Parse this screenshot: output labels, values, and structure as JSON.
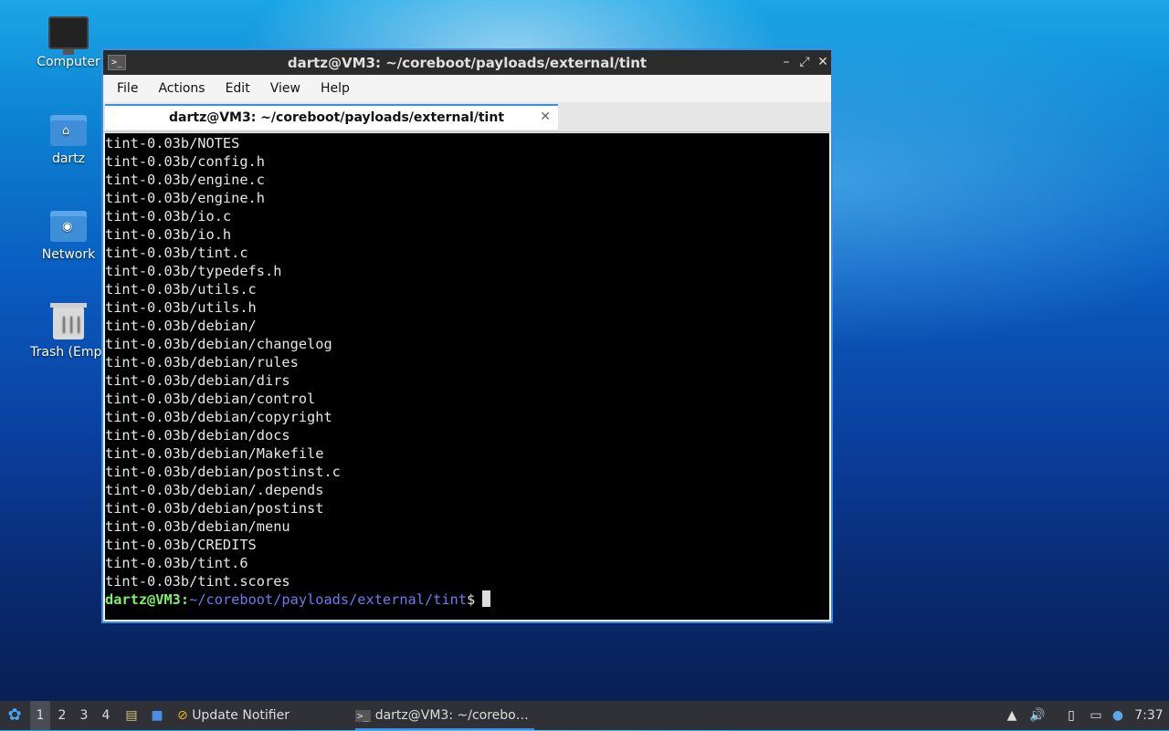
{
  "desktop": {
    "icons": [
      {
        "label": "Computer"
      },
      {
        "label": "dartz"
      },
      {
        "label": "Network"
      },
      {
        "label": "Trash (Empt"
      }
    ]
  },
  "window": {
    "title": "dartz@VM3: ~/coreboot/payloads/external/tint",
    "menu": [
      "File",
      "Actions",
      "Edit",
      "View",
      "Help"
    ],
    "tab_label": "dartz@VM3: ~/coreboot/payloads/external/tint",
    "controls": {
      "minimize": "–",
      "maximize": "⤢",
      "close": "✕"
    }
  },
  "terminal": {
    "lines": [
      "tint-0.03b/NOTES",
      "tint-0.03b/config.h",
      "tint-0.03b/engine.c",
      "tint-0.03b/engine.h",
      "tint-0.03b/io.c",
      "tint-0.03b/io.h",
      "tint-0.03b/tint.c",
      "tint-0.03b/typedefs.h",
      "tint-0.03b/utils.c",
      "tint-0.03b/utils.h",
      "tint-0.03b/debian/",
      "tint-0.03b/debian/changelog",
      "tint-0.03b/debian/rules",
      "tint-0.03b/debian/dirs",
      "tint-0.03b/debian/control",
      "tint-0.03b/debian/copyright",
      "tint-0.03b/debian/docs",
      "tint-0.03b/debian/Makefile",
      "tint-0.03b/debian/postinst.c",
      "tint-0.03b/debian/.depends",
      "tint-0.03b/debian/postinst",
      "tint-0.03b/debian/menu",
      "tint-0.03b/CREDITS",
      "tint-0.03b/tint.6",
      "tint-0.03b/tint.scores"
    ],
    "prompt": {
      "user": "dartz@VM3",
      "sep": ":",
      "path": "~/coreboot/payloads/external/tint",
      "symbol": "$"
    }
  },
  "taskbar": {
    "workspaces": [
      "1",
      "2",
      "3",
      "4"
    ],
    "tasks": [
      {
        "label": "Update Notifier"
      },
      {
        "label": "dartz@VM3: ~/corebo…"
      }
    ],
    "clock": "7:37"
  }
}
